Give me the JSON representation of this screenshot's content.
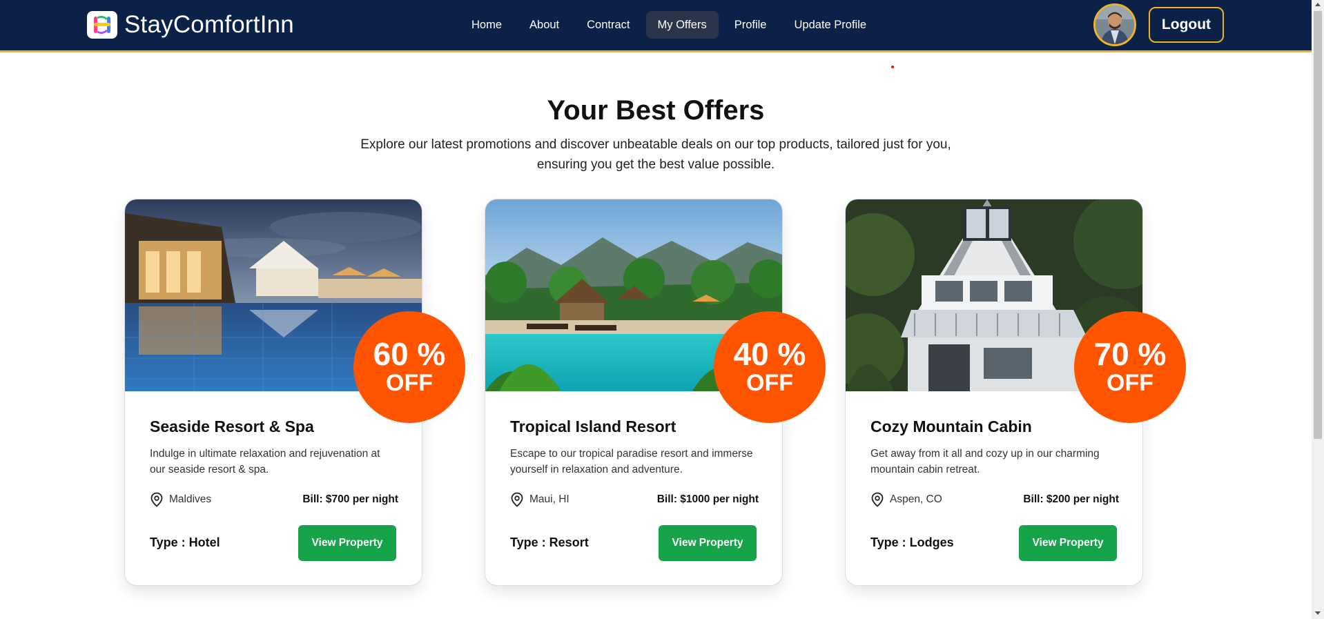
{
  "brand": {
    "name": "StayComfortInn",
    "logo_icon": "brand-logo-icon"
  },
  "nav": {
    "items": [
      {
        "label": "Home",
        "active": false
      },
      {
        "label": "About",
        "active": false
      },
      {
        "label": "Contract",
        "active": false
      },
      {
        "label": "My Offers",
        "active": true
      },
      {
        "label": "Profile",
        "active": false
      },
      {
        "label": "Update Profile",
        "active": false
      }
    ],
    "logout_label": "Logout"
  },
  "hero": {
    "title": "Your Best Offers",
    "subtitle": "Explore our latest promotions and discover unbeatable deals on our top products, tailored just for you, ensuring you get the best value possible."
  },
  "offers": [
    {
      "title": "Seaside Resort & Spa",
      "description": "Indulge in ultimate relaxation and rejuvenation at our seaside resort & spa.",
      "location": "Maldives",
      "bill": "Bill: $700 per night",
      "type": "Type : Hotel",
      "discount": "60 %",
      "discount_off": "OFF",
      "button": "View Property"
    },
    {
      "title": "Tropical Island Resort",
      "description": "Escape to our tropical paradise resort and immerse yourself in relaxation and adventure.",
      "location": "Maui, HI",
      "bill": "Bill: $1000 per night",
      "type": "Type : Resort",
      "discount": "40 %",
      "discount_off": "OFF",
      "button": "View Property"
    },
    {
      "title": "Cozy Mountain Cabin",
      "description": "Get away from it all and cozy up in our charming mountain cabin retreat.",
      "location": "Aspen, CO",
      "bill": "Bill: $200 per night",
      "type": "Type : Lodges",
      "discount": "70 %",
      "discount_off": "OFF",
      "button": "View Property"
    }
  ],
  "colors": {
    "navbar": "#0b2148",
    "accent": "#f0b323",
    "badge": "#ff5500",
    "button": "#16a34a"
  }
}
